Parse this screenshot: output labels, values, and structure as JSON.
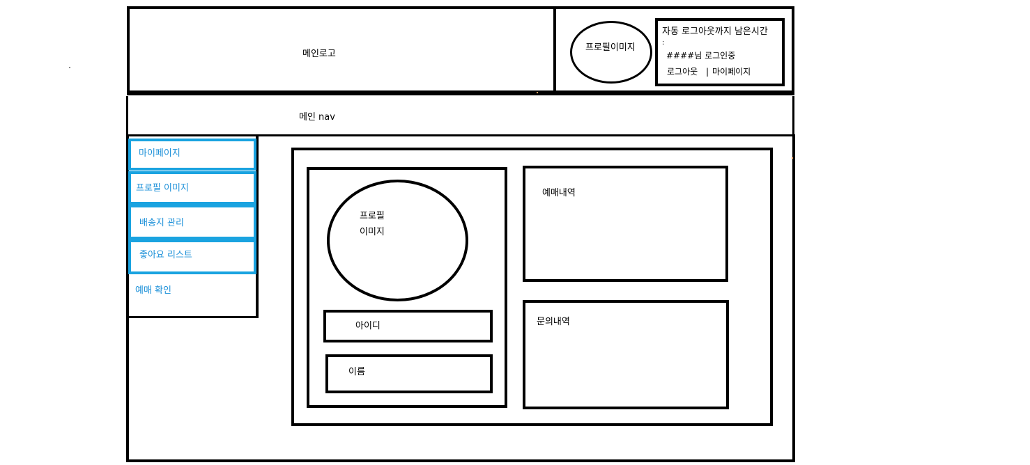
{
  "header": {
    "logo_label": "메인로고",
    "profile_image_label": "프로필이미지",
    "login": {
      "auto_logout_label": "자동 로그아웃까지 남은시간",
      "colon": ":",
      "user_status": "####님 로그인중",
      "logout_label": "로그아웃",
      "separator": "|",
      "mypage_label": "마이페이지"
    }
  },
  "nav": {
    "label": "메인 nav"
  },
  "sidebar": {
    "items": [
      {
        "label": "마이페이지"
      },
      {
        "label": "프로필 이미지"
      },
      {
        "label": "배송지 관리"
      },
      {
        "label": "좋아요 리스트"
      },
      {
        "label": "예매 확인"
      }
    ]
  },
  "content": {
    "profile_image_line1": "프로필",
    "profile_image_line2": "이미지",
    "id_label": "아이디",
    "name_label": "이름",
    "booking_history_label": "예매내역",
    "inquiry_history_label": "문의내역"
  },
  "colors": {
    "sidebar_accent": "#1aa3e0",
    "sidebar_text": "#1a8fd8",
    "stroke": "#000000"
  }
}
